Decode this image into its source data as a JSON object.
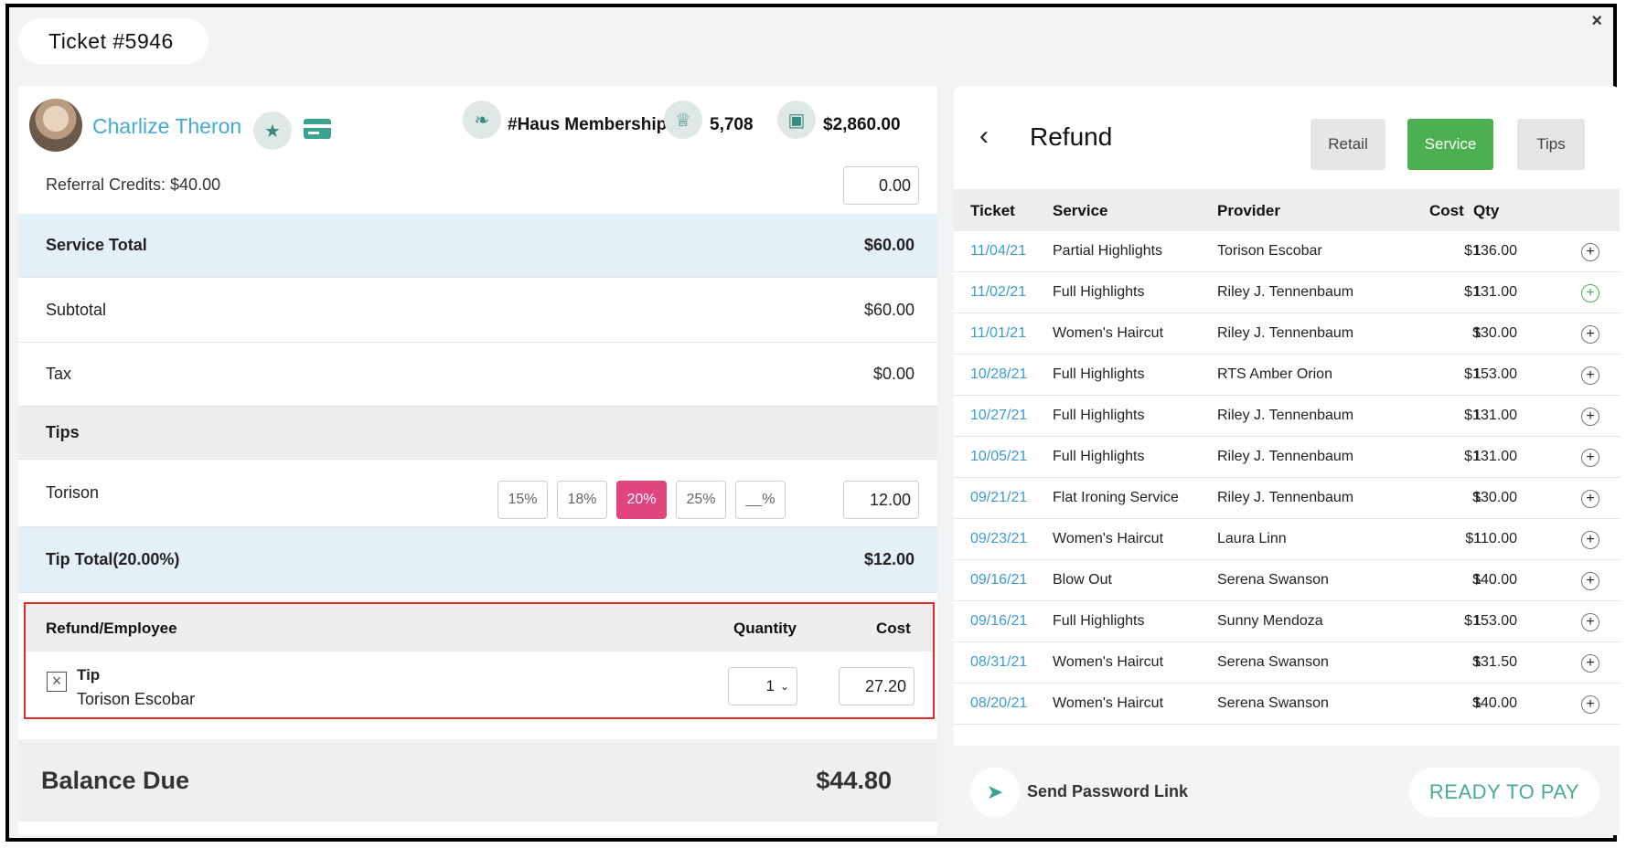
{
  "window": {
    "title": "Ticket #5946",
    "close_glyph": "×"
  },
  "client": {
    "name": "Charlize Theron",
    "membership": "#Haus Membership",
    "points": "5,708",
    "gift_balance": "$2,860.00",
    "icons": [
      "star-icon",
      "credit-card-icon",
      "leaf-icon",
      "trophy-icon",
      "gift-icon"
    ]
  },
  "referral": {
    "label": "Referral Credits: $40.00",
    "value": "0.00"
  },
  "summary": {
    "service_total_label": "Service Total",
    "service_total": "$60.00",
    "subtotal_label": "Subtotal",
    "subtotal": "$60.00",
    "tax_label": "Tax",
    "tax": "$0.00",
    "tips_label": "Tips",
    "tip_employee": "Torison",
    "tip_options": [
      "15%",
      "18%",
      "20%",
      "25%",
      "__%"
    ],
    "tip_selected": "20%",
    "tip_value": "12.00",
    "tip_total_label": "Tip Total(20.00%)",
    "tip_total": "$12.00"
  },
  "refund_section": {
    "col_employee": "Refund/Employee",
    "col_quantity": "Quantity",
    "col_cost": "Cost",
    "item": {
      "type": "Tip",
      "employee": "Torison Escobar",
      "quantity": "1",
      "cost": "27.20"
    }
  },
  "balance": {
    "label": "Balance Due",
    "value": "$44.80"
  },
  "refund_panel": {
    "title": "Refund",
    "tabs": [
      "Retail",
      "Service",
      "Tips"
    ],
    "active_tab": "Service",
    "columns": {
      "ticket": "Ticket",
      "service": "Service",
      "provider": "Provider",
      "cost": "Cost",
      "qty": "Qty"
    },
    "rows": [
      {
        "date": "11/04/21",
        "service": "Partial Highlights",
        "provider": "Torison Escobar",
        "cost": "$136.00",
        "qty": "1"
      },
      {
        "date": "11/02/21",
        "service": "Full Highlights",
        "provider": "Riley J. Tennenbaum",
        "cost": "$131.00",
        "qty": "1"
      },
      {
        "date": "11/01/21",
        "service": "Women's Haircut",
        "provider": "Riley J. Tennenbaum",
        "cost": "$30.00",
        "qty": "1"
      },
      {
        "date": "10/28/21",
        "service": "Full Highlights",
        "provider": "RTS Amber Orion",
        "cost": "$153.00",
        "qty": "1"
      },
      {
        "date": "10/27/21",
        "service": "Full Highlights",
        "provider": "Riley J. Tennenbaum",
        "cost": "$131.00",
        "qty": "1"
      },
      {
        "date": "10/05/21",
        "service": "Full Highlights",
        "provider": "Riley J. Tennenbaum",
        "cost": "$131.00",
        "qty": "1"
      },
      {
        "date": "09/21/21",
        "service": "Flat Ironing Service",
        "provider": "Riley J. Tennenbaum",
        "cost": "$30.00",
        "qty": "1"
      },
      {
        "date": "09/23/21",
        "service": "Women's Haircut",
        "provider": "Laura Linn",
        "cost": "$110.00",
        "qty": "1"
      },
      {
        "date": "09/16/21",
        "service": "Blow Out",
        "provider": "Serena Swanson",
        "cost": "$40.00",
        "qty": "1"
      },
      {
        "date": "09/16/21",
        "service": "Full Highlights",
        "provider": "Sunny Mendoza",
        "cost": "$153.00",
        "qty": "1"
      },
      {
        "date": "08/31/21",
        "service": "Women's Haircut",
        "provider": "Serena Swanson",
        "cost": "$31.50",
        "qty": "1"
      },
      {
        "date": "08/20/21",
        "service": "Women's Haircut",
        "provider": "Serena Swanson",
        "cost": "$40.00",
        "qty": "1"
      }
    ]
  },
  "footer": {
    "send_link": "Send Password Link",
    "pay_button": "READY TO PAY"
  },
  "colors": {
    "accent_teal": "#3aa38f",
    "link_blue": "#45a9d6",
    "tip_active": "#e0457e",
    "tab_active": "#4caf50",
    "highlight_red": "#e02a2a"
  }
}
